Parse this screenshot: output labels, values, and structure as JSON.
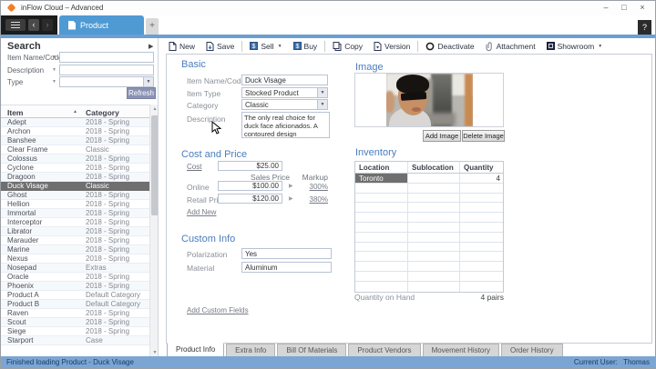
{
  "window": {
    "title": "inFlow Cloud – Advanced"
  },
  "tabs": {
    "product": "Product",
    "new_tab": "+",
    "help": "?"
  },
  "glyphs": {
    "minimize": "–",
    "maximize": "□",
    "close": "×",
    "back": "‹",
    "forward": "›",
    "expander": "▶",
    "dropdown": "▼",
    "filter": "▼",
    "sort_asc": "▲",
    "scroll_up": "▲",
    "scroll_down": "▼",
    "play": "▶"
  },
  "colors": {
    "accent_blue": "#4f9ad3",
    "section_blue": "#4a7dbe",
    "selection_gray": "#6f6f6f",
    "status_blue": "#7ba6d4",
    "refresh_btn": "#8a93b4",
    "logo_orange": "#f07d28"
  },
  "toolbar": {
    "items": [
      {
        "label": "New",
        "icon": "doc",
        "icon_name": "new-icon"
      },
      {
        "label": "Save",
        "icon": "save",
        "icon_name": "save-icon"
      },
      {
        "sep": true
      },
      {
        "label": "Sell",
        "icon": "sell",
        "icon_name": "sell-icon",
        "dropdown": true
      },
      {
        "label": "Buy",
        "icon": "buy",
        "icon_name": "buy-icon"
      },
      {
        "sep": true
      },
      {
        "label": "Copy",
        "icon": "copy",
        "icon_name": "copy-icon"
      },
      {
        "label": "Version",
        "icon": "version",
        "icon_name": "version-icon"
      },
      {
        "sep": true
      },
      {
        "label": "Deactivate",
        "icon": "deactivate",
        "icon_name": "deactivate-icon"
      },
      {
        "label": "Attachment",
        "icon": "attach",
        "icon_name": "attachment-icon"
      },
      {
        "label": "Showroom",
        "icon": "showroom",
        "icon_name": "showroom-icon",
        "dropdown": true
      }
    ]
  },
  "search": {
    "title": "Search",
    "refresh": "Refresh",
    "fields": [
      {
        "label": "Item Name/Code",
        "value": "",
        "kind": "text"
      },
      {
        "label": "Description",
        "value": "",
        "kind": "text"
      },
      {
        "label": "Type",
        "value": "",
        "kind": "select"
      }
    ]
  },
  "item_list": {
    "columns": [
      "Item",
      "Category"
    ],
    "selected_item": "Duck Visage",
    "rows": [
      {
        "item": "Adept",
        "category": "2018 - Spring"
      },
      {
        "item": "Archon",
        "category": "2018 - Spring"
      },
      {
        "item": "Banshee",
        "category": "2018 - Spring"
      },
      {
        "item": "Clear Frame",
        "category": "Classic"
      },
      {
        "item": "Colossus",
        "category": "2018 - Spring"
      },
      {
        "item": "Cyclone",
        "category": "2018 - Spring"
      },
      {
        "item": "Dragoon",
        "category": "2018 - Spring"
      },
      {
        "item": "Duck Visage",
        "category": "Classic"
      },
      {
        "item": "Ghost",
        "category": "2018 - Spring"
      },
      {
        "item": "Hellion",
        "category": "2018 - Spring"
      },
      {
        "item": "Immortal",
        "category": "2018 - Spring"
      },
      {
        "item": "Interceptor",
        "category": "2018 - Spring"
      },
      {
        "item": "Librator",
        "category": "2018 - Spring"
      },
      {
        "item": "Marauder",
        "category": "2018 - Spring"
      },
      {
        "item": "Marine",
        "category": "2018 - Spring"
      },
      {
        "item": "Nexus",
        "category": "2018 - Spring"
      },
      {
        "item": "Nosepad",
        "category": "Extras"
      },
      {
        "item": "Oracle",
        "category": "2018 - Spring"
      },
      {
        "item": "Phoenix",
        "category": "2018 - Spring"
      },
      {
        "item": "Product A",
        "category": "Default Category"
      },
      {
        "item": "Product B",
        "category": "Default Category"
      },
      {
        "item": "Raven",
        "category": "2018 - Spring"
      },
      {
        "item": "Scout",
        "category": "2018 - Spring"
      },
      {
        "item": "Siege",
        "category": "2018 - Spring"
      },
      {
        "item": "Starport",
        "category": "Case"
      }
    ]
  },
  "form": {
    "basic": {
      "title": "Basic",
      "item_name_label": "Item Name/Code",
      "item_name": "Duck Visage",
      "item_type_label": "Item Type",
      "item_type": "Stocked Product",
      "category_label": "Category",
      "category": "Classic",
      "description_label": "Description",
      "description": "The only real choice for duck face aficionados. A contoured design complements pursed lips."
    },
    "cost_price": {
      "title": "Cost and Price",
      "cost_label": "Cost",
      "cost": "$25.00",
      "sales_price_header": "Sales Price",
      "markup_header": "Markup",
      "rows": [
        {
          "label": "Online",
          "price": "$100.00",
          "markup": "300%"
        },
        {
          "label": "Retail Price",
          "price": "$120.00",
          "markup": "380%"
        }
      ],
      "add_new": "Add New"
    },
    "custom": {
      "title": "Custom Info",
      "fields": [
        {
          "label": "Polarization",
          "value": "Yes"
        },
        {
          "label": "Material",
          "value": "Aluminum"
        }
      ],
      "add_custom": "Add Custom Fields"
    },
    "image": {
      "title": "Image",
      "add_label": "Add Image",
      "delete_label": "Delete Image"
    },
    "inventory": {
      "title": "Inventory",
      "columns": [
        "Location",
        "Sublocation",
        "Quantity"
      ],
      "rows": [
        {
          "location": "Toronto",
          "sublocation": "",
          "quantity": "4"
        }
      ],
      "empty_rows": 11,
      "qoh_label": "Quantity on Hand",
      "qoh_value": "4 pairs"
    }
  },
  "bottom_tabs": [
    {
      "label": "Product Info",
      "active": true
    },
    {
      "label": "Extra Info",
      "active": false
    },
    {
      "label": "Bill Of Materials",
      "active": false
    },
    {
      "label": "Product Vendors",
      "active": false
    },
    {
      "label": "Movement History",
      "active": false
    },
    {
      "label": "Order History",
      "active": false
    }
  ],
  "status": {
    "left": "Finished loading Product - Duck Visage",
    "user_label": "Current User:",
    "user_value": "Thomas"
  }
}
